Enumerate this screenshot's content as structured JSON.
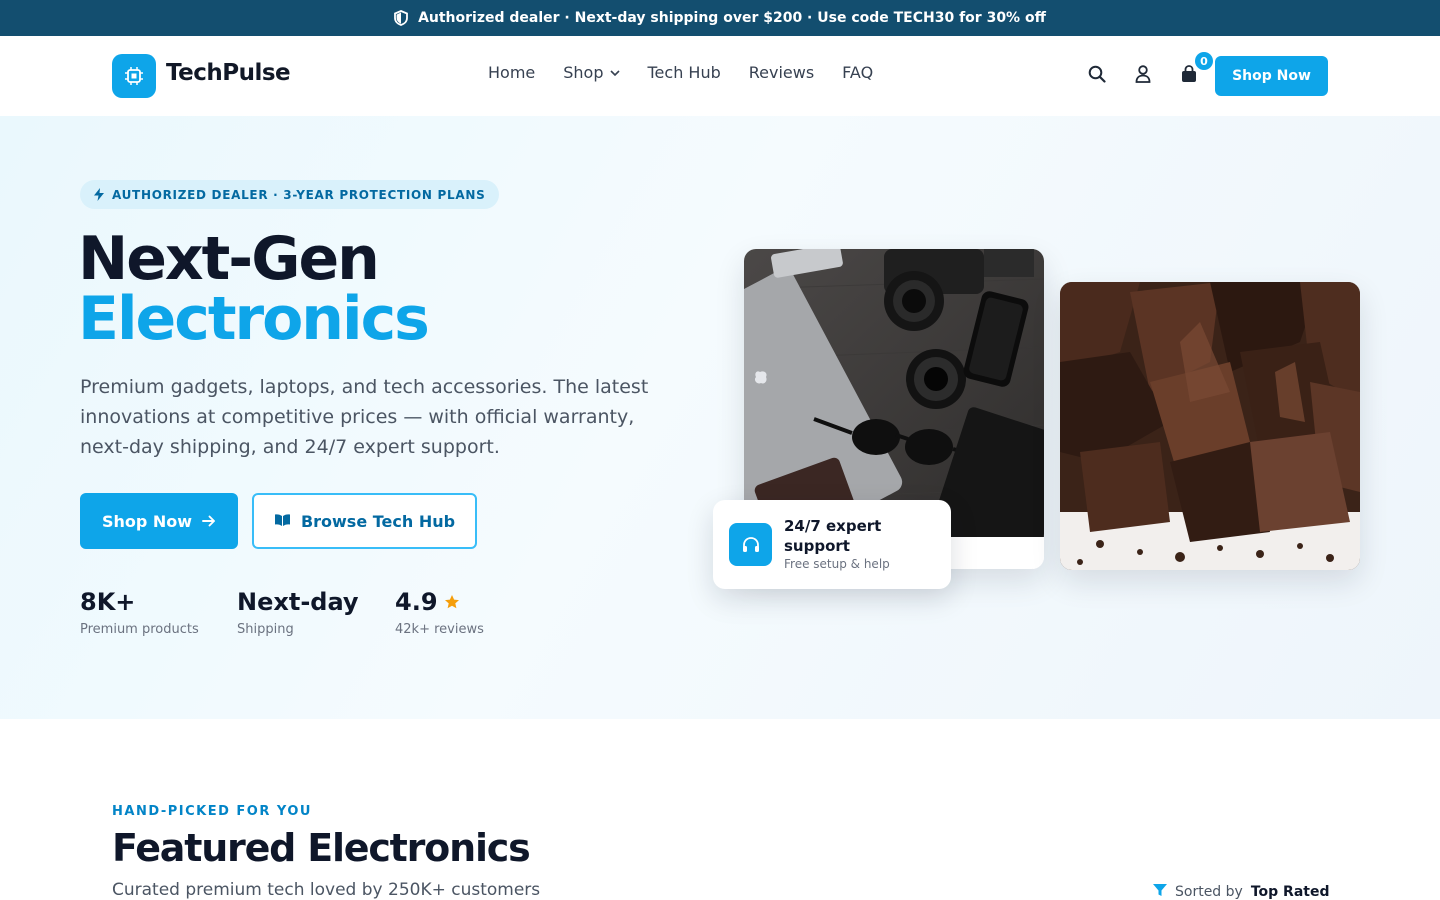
{
  "announcement": {
    "text": "Authorized dealer · Next-day shipping over $200 · Use code TECH30 for 30% off",
    "icon": "shield-icon"
  },
  "header": {
    "brand": "TechPulse",
    "nav": [
      "Home",
      "Shop",
      "Tech Hub",
      "Reviews",
      "FAQ"
    ],
    "cart_count": "0",
    "cta_label": "Shop Now"
  },
  "hero": {
    "pill": "AUTHORIZED DEALER · 3-YEAR PROTECTION PLANS",
    "title_line1": "Next-Gen",
    "title_line2": "Electronics",
    "lead": "Premium gadgets, laptops, and tech accessories. The latest innovations at competitive prices — with official warranty, next-day shipping, and 24/7 expert support.",
    "primary_cta": "Shop Now",
    "secondary_cta": "Browse Tech Hub",
    "stats": [
      {
        "value": "8K+",
        "label": "Premium products"
      },
      {
        "value": "Next-day",
        "label": "Shipping"
      },
      {
        "value": "4.9",
        "label": "42k+ reviews"
      }
    ],
    "support_card": {
      "title": "24/7 expert support",
      "subtitle": "Free setup & help"
    }
  },
  "featured": {
    "eyebrow": "HAND-PICKED FOR YOU",
    "title": "Featured Electronics",
    "subtitle": "Curated premium tech loved by 250K+ customers",
    "sort_label": "Sorted by",
    "sort_value": "Top Rated"
  },
  "colors": {
    "accent": "#0ea5e9",
    "announcement_bg": "#134e6f",
    "heading": "#0f172a",
    "star": "#f59e0b"
  }
}
